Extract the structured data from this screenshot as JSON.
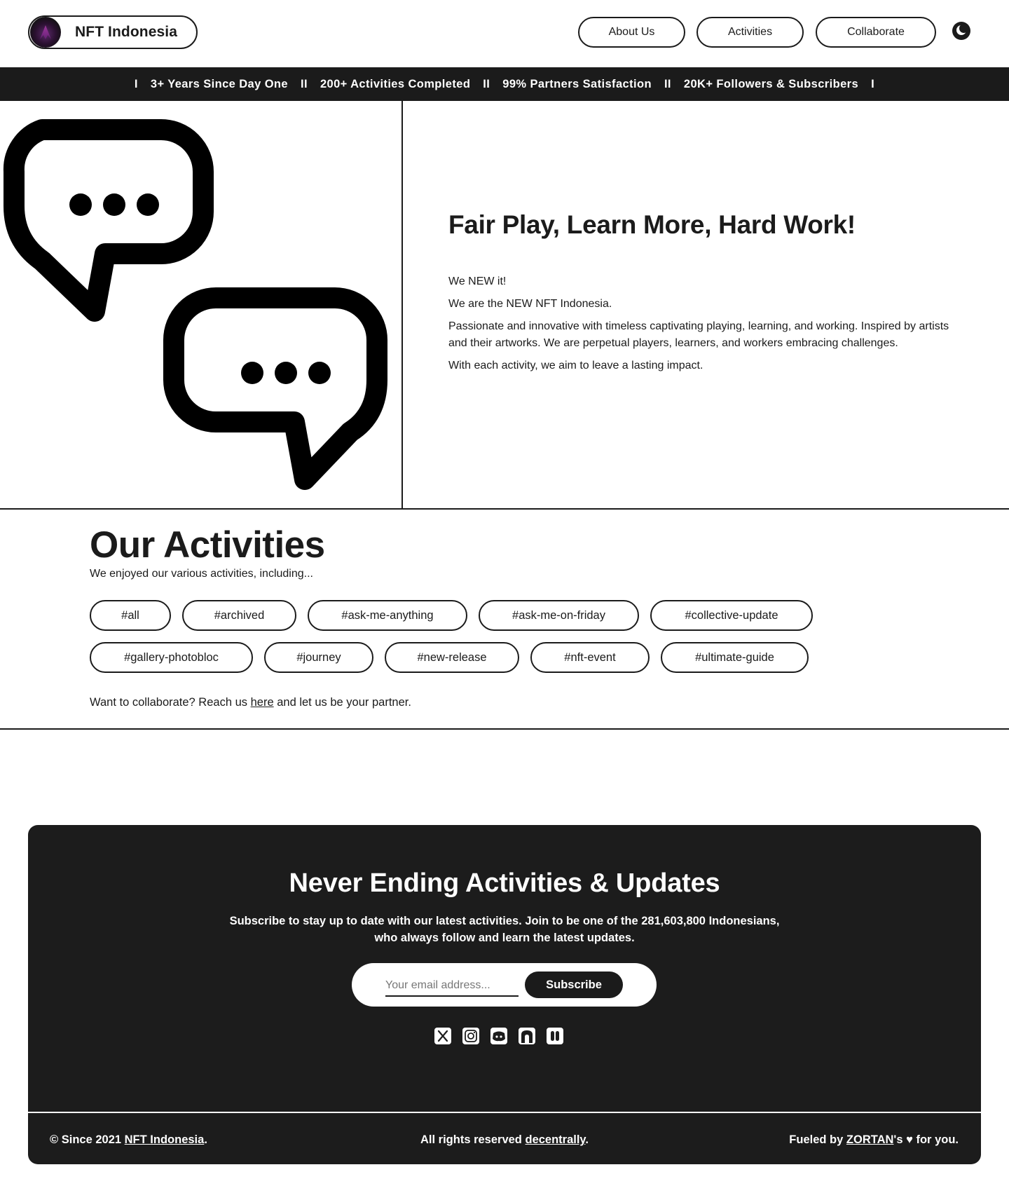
{
  "header": {
    "brand_name": "NFT Indonesia",
    "nav": [
      "About Us",
      "Activities",
      "Collaborate"
    ],
    "theme_toggle_icon": "moon-icon"
  },
  "stats": {
    "items": [
      "3+ Years Since Day One",
      "200+ Activities Completed",
      "99% Partners Satisfaction",
      "20K+ Followers & Subscribers"
    ],
    "separator_edge": "I",
    "separator_mid": "II"
  },
  "hero": {
    "illustration_icon": "chat-bubbles-icon",
    "title": "Fair Play, Learn More, Hard Work!",
    "paragraphs": [
      "We NEW it!",
      "We are the NEW NFT Indonesia.",
      "Passionate and innovative with timeless captivating playing, learning, and working. Inspired by artists and their artworks. We are perpetual players, learners, and workers embracing challenges.",
      "With each activity, we aim to leave a lasting impact."
    ]
  },
  "activities": {
    "title": "Our Activities",
    "subtitle": "We enjoyed our various activities, including...",
    "tags": [
      "#all",
      "#archived",
      "#ask-me-anything",
      "#ask-me-on-friday",
      "#collective-update",
      "#gallery-photobloc",
      "#journey",
      "#new-release",
      "#nft-event",
      "#ultimate-guide"
    ],
    "collab_prefix": "Want to collaborate? Reach us ",
    "collab_link": "here",
    "collab_suffix": " and let us be your partner."
  },
  "newsletter": {
    "title": "Never Ending Activities & Updates",
    "description": "Subscribe to stay up to date with our latest activities. Join to be one of the 281,603,800 Indonesians, who always follow and learn the latest updates.",
    "email_placeholder": "Your email address...",
    "subscribe_label": "Subscribe",
    "socials": [
      "x-icon",
      "instagram-icon",
      "discord-icon",
      "opensea-icon",
      "medium-icon"
    ]
  },
  "footer": {
    "left_prefix": "© Since 2021 ",
    "left_link": "NFT Indonesia",
    "left_suffix": ".",
    "mid_prefix": "All rights reserved ",
    "mid_link": "decentrally",
    "mid_suffix": ".",
    "right_prefix": "Fueled by ",
    "right_link": "ZORTAN",
    "right_suffix": "'s ♥ for you."
  },
  "colors": {
    "primary": "#1b1b1b",
    "background": "#ffffff"
  }
}
